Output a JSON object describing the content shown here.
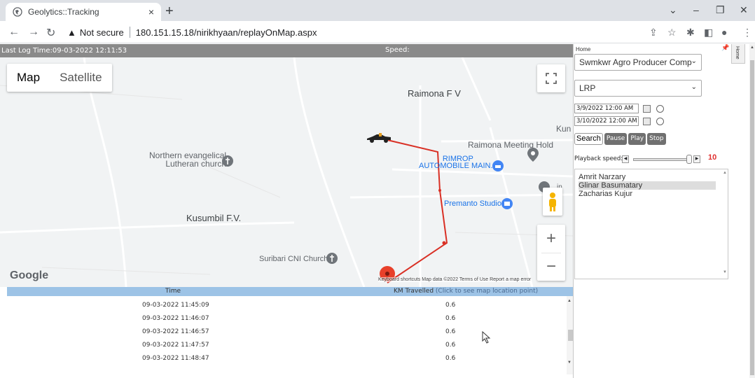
{
  "browser": {
    "tab_title": "Geolytics::Tracking",
    "tab_close": "×",
    "new_tab": "+",
    "not_secure": "Not secure",
    "url": "180.151.15.18/nirikhyaan/replayOnMap.aspx",
    "icons": [
      "back-arrow-icon",
      "forward-arrow-icon",
      "reload-icon",
      "warning-icon",
      "share-icon",
      "star-icon",
      "extensions-icon",
      "sidebar-icon",
      "profile-icon",
      "menu-icon"
    ]
  },
  "status": {
    "last_log_label": "Last Log Time:",
    "last_log_value": "09-03-2022 12:11:53",
    "speed_label": "Speed:"
  },
  "map": {
    "map_tab": "Map",
    "satellite_tab": "Satellite",
    "zoom_in": "+",
    "zoom_out": "−",
    "google": "Google",
    "attribution": "Keyboard shortcuts   Map data ©2022   Terms of Use   Report a map error",
    "places": {
      "raimona_fv": "Raimona F V",
      "kun": "Kun",
      "raimona_meeting": "Raimona Meeting Hold",
      "northern_church": "Northern evangelical\nLutheran church",
      "rimrop": "RIMROP\nAUTOMOBILE MAIN...",
      "premanto": "Premanto Studio",
      "kusumbil": "Kusumbil F.V.",
      "suribari": "Suribari CNI Church",
      "in": "in"
    },
    "route_color": "#d93025",
    "marker_color": "#e8402a"
  },
  "table": {
    "col_time": "Time",
    "col_km": "KM Travelled",
    "col_km_hint": "(Click to see map location point)",
    "rows": [
      {
        "time": "09-03-2022 11:45:09",
        "km": "0.6"
      },
      {
        "time": "09-03-2022 11:46:07",
        "km": "0.6"
      },
      {
        "time": "09-03-2022 11:46:57",
        "km": "0.6"
      },
      {
        "time": "09-03-2022 11:47:57",
        "km": "0.6"
      },
      {
        "time": "09-03-2022 11:48:47",
        "km": "0.6"
      }
    ]
  },
  "panel": {
    "home_label": "Home",
    "home_vtab": "Home",
    "company_select": "Swmkwr Agro Producer Comp",
    "type_select": "LRP",
    "from_datetime": "3/9/2022 12:00 AM",
    "to_datetime": "3/10/2022 12:00 AM",
    "buttons": {
      "search": "Search",
      "pause": "Pause",
      "play": "Play",
      "stop": "Stop"
    },
    "playback_label": "Playback speed:",
    "playback_value": "10",
    "people": [
      "Amrit Narzary",
      "Glinar Basumatary",
      "Zacharias Kujur"
    ],
    "selected_person": "Glinar Basumatary"
  }
}
